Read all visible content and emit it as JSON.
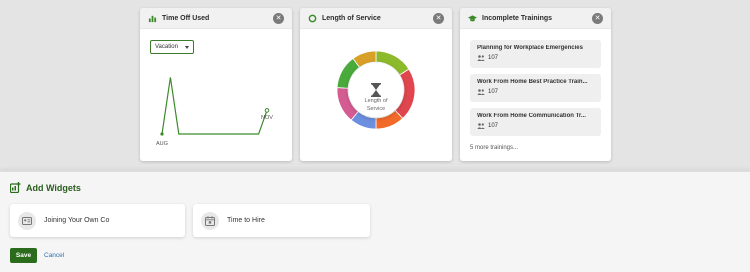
{
  "cards": {
    "timeoff": {
      "title": "Time Off Used",
      "icon": "bar-chart-icon",
      "select_value": "Vacation",
      "x_start_label": "AUG",
      "x_end_label": "NOV",
      "chart_data": {
        "type": "line",
        "x": [
          "AUG",
          "",
          "",
          "",
          "",
          "",
          "",
          "",
          "",
          "",
          "NOV"
        ],
        "values": [
          0,
          6,
          0,
          0,
          0,
          0,
          0,
          0,
          0,
          0,
          2.5
        ],
        "ylim": [
          0,
          7
        ]
      }
    },
    "service": {
      "title": "Length of Service",
      "icon": "circle-icon",
      "center_line1": "Length of",
      "center_line2": "Service",
      "chart_data": {
        "type": "pie",
        "slices": [
          {
            "value": 16,
            "color": "#8cba2a"
          },
          {
            "value": 22,
            "color": "#e0464e"
          },
          {
            "value": 12,
            "color": "#f26a2a"
          },
          {
            "value": 11,
            "color": "#6c8fe0"
          },
          {
            "value": 15,
            "color": "#d45c92"
          },
          {
            "value": 14,
            "color": "#4aab3c"
          },
          {
            "value": 10,
            "color": "#d8a028"
          }
        ]
      }
    },
    "trainings": {
      "title": "Incomplete Trainings",
      "icon": "graduation-cap-icon",
      "items": [
        {
          "name": "Planning for Workplace Emergencies",
          "count": "107"
        },
        {
          "name": "Work From Home Best Practice Train...",
          "count": "107"
        },
        {
          "name": "Work From Home Communication Tr...",
          "count": "107"
        }
      ],
      "more_label": "5 more trainings..."
    }
  },
  "add_widgets": {
    "title": "Add Widgets",
    "options": [
      {
        "label": "Joining Your Own Co",
        "icon": "id-card-icon"
      },
      {
        "label": "Time to Hire",
        "icon": "calendar-icon"
      }
    ]
  },
  "actions": {
    "save_label": "Save",
    "cancel_label": "Cancel"
  },
  "colors": {
    "brand_green": "#2a6c1b",
    "link_blue": "#2f6fae"
  }
}
